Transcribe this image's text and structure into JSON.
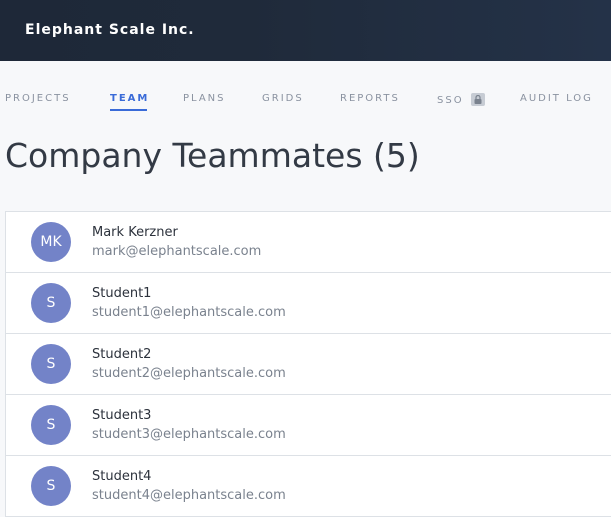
{
  "header": {
    "org_name": "Elephant Scale Inc."
  },
  "tabs": [
    {
      "label": "PROJECTS",
      "active": false
    },
    {
      "label": "TEAM",
      "active": true
    },
    {
      "label": "PLANS",
      "active": false
    },
    {
      "label": "GRIDS",
      "active": false
    },
    {
      "label": "REPORTS",
      "active": false
    },
    {
      "label": "SSO",
      "active": false,
      "icon": "lock-icon"
    },
    {
      "label": "AUDIT LOG",
      "active": false
    }
  ],
  "page": {
    "title": "Company Teammates (5)"
  },
  "members": [
    {
      "initials": "MK",
      "name": "Mark Kerzner",
      "email": "mark@elephantscale.com"
    },
    {
      "initials": "S",
      "name": "Student1",
      "email": "student1@elephantscale.com"
    },
    {
      "initials": "S",
      "name": "Student2",
      "email": "student2@elephantscale.com"
    },
    {
      "initials": "S",
      "name": "Student3",
      "email": "student3@elephantscale.com"
    },
    {
      "initials": "S",
      "name": "Student4",
      "email": "student4@elephantscale.com"
    }
  ],
  "colors": {
    "header_bg": "#1e2838",
    "accent": "#3a6bd8",
    "avatar_bg": "#7383c8"
  }
}
